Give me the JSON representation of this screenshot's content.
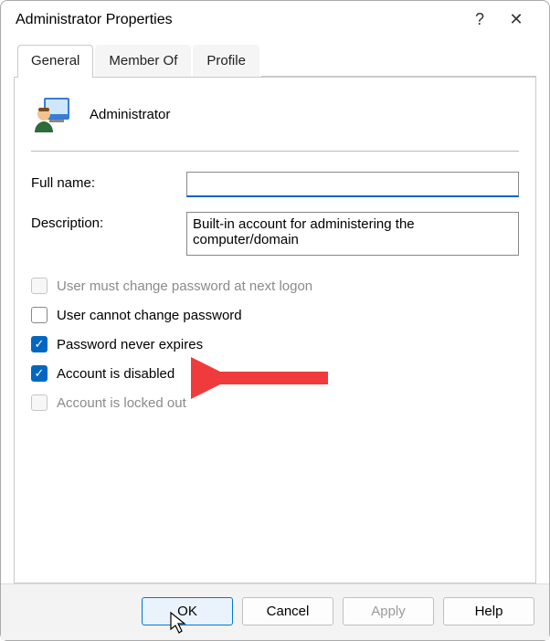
{
  "window": {
    "title": "Administrator Properties",
    "help": "?",
    "close": "✕"
  },
  "tabs": {
    "general": "General",
    "member_of": "Member Of",
    "profile": "Profile"
  },
  "account": {
    "name": "Administrator"
  },
  "fields": {
    "fullname_label": "Full name:",
    "fullname_value": "",
    "description_label": "Description:",
    "description_value": "Built-in account for administering the computer/domain"
  },
  "checkboxes": {
    "must_change": {
      "label": "User must change password at next logon",
      "checked": false,
      "enabled": false
    },
    "cannot_change": {
      "label": "User cannot change password",
      "checked": false,
      "enabled": true
    },
    "never_expires": {
      "label": "Password never expires",
      "checked": true,
      "enabled": true
    },
    "disabled": {
      "label": "Account is disabled",
      "checked": true,
      "enabled": true
    },
    "locked": {
      "label": "Account is locked out",
      "checked": false,
      "enabled": false
    }
  },
  "buttons": {
    "ok": "OK",
    "cancel": "Cancel",
    "apply": "Apply",
    "help": "Help"
  },
  "annotation": {
    "arrow_color": "#ef3b3b"
  }
}
